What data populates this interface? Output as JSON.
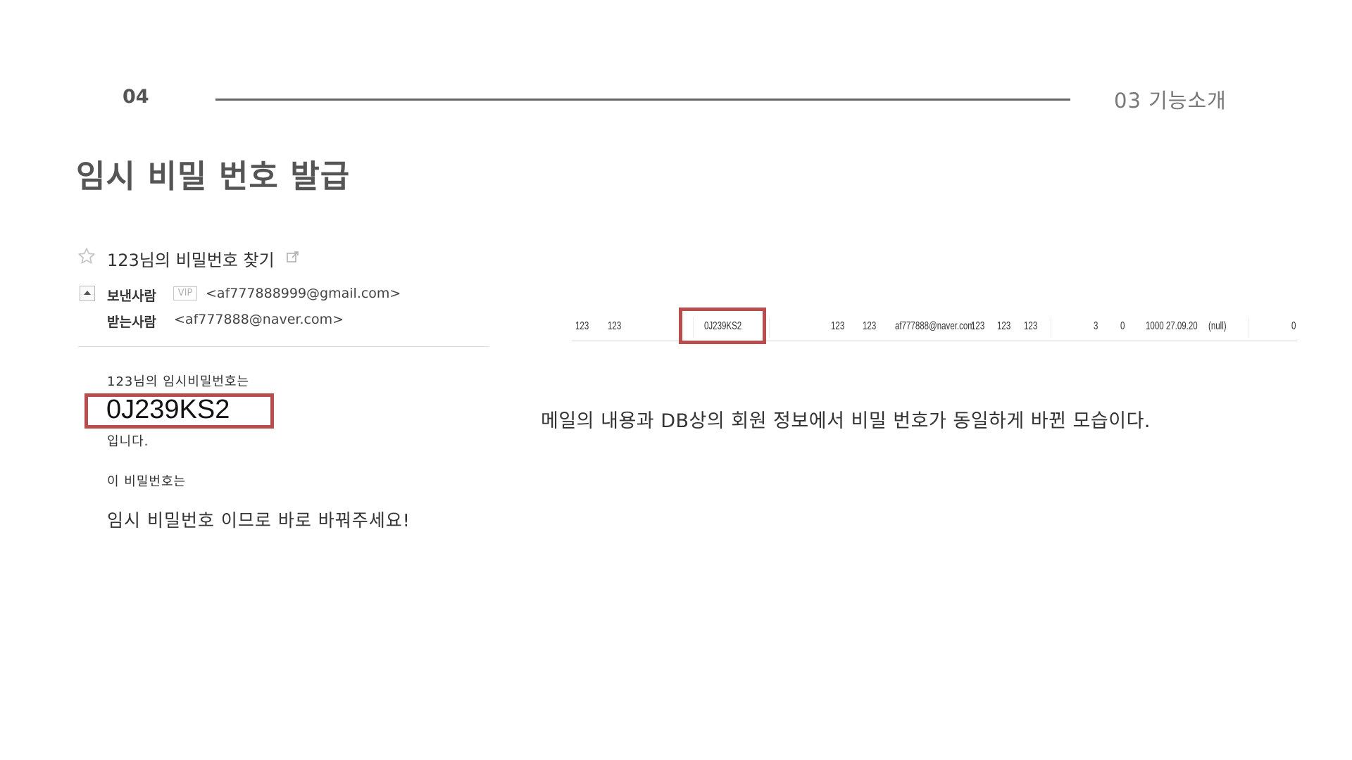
{
  "header": {
    "page_number": "04",
    "section_title": "03  기능소개"
  },
  "title": "임시 비밀 번호 발급",
  "email": {
    "subject": "123님의 비밀번호 찾기",
    "sender_label": "보낸사람",
    "vip_badge": "VIP",
    "sender_email": "<af777888999@gmail.com>",
    "recipient_label": "받는사람",
    "recipient_email": "<af777888@naver.com>",
    "body_line1": "123님의 임시비밀번호는",
    "temp_password": "0J239KS2",
    "body_line2": "입니다.",
    "body_line3": "이 비밀번호는",
    "body_line4": "임시 비밀번호 이므로 바로 바꿔주세요!"
  },
  "db_row": {
    "cells": [
      "123",
      "123",
      "0J239KS2",
      "123",
      "123",
      "af777888@naver.com",
      "123",
      "123",
      "123",
      "3",
      "0",
      "1000 27.09.20",
      "(null)",
      "0"
    ]
  },
  "caption": "메일의 내용과 DB상의 회원 정보에서 비밀 번호가 동일하게 바뀐 모습이다.",
  "colors": {
    "highlight": "#b94c4c",
    "rule": "#666666",
    "text": "#333333"
  }
}
